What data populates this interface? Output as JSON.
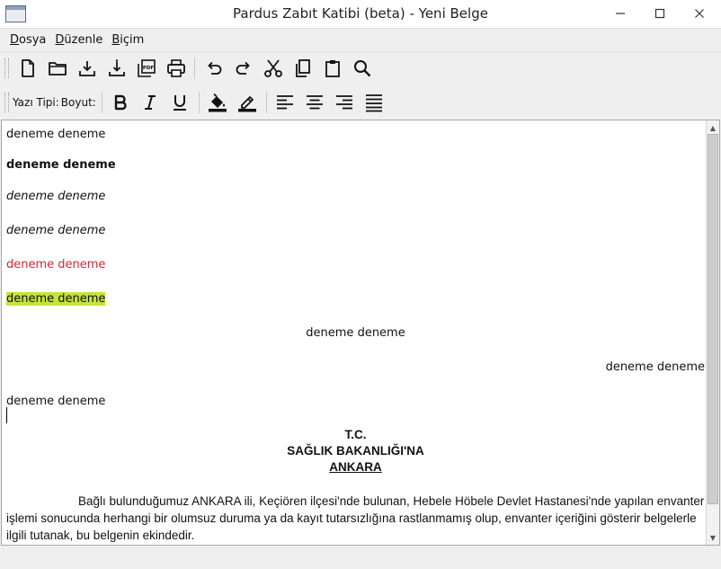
{
  "window": {
    "title": "Pardus Zabıt Katibi (beta) - Yeni Belge"
  },
  "menu": [
    {
      "accel": "D",
      "rest": "osya"
    },
    {
      "accel": "D",
      "rest": "üzenle"
    },
    {
      "accel": "B",
      "rest": "içim"
    }
  ],
  "format_toolbar": {
    "font_label": "Yazı Tipi:",
    "size_label": "Boyut:"
  },
  "document": {
    "lines": [
      "deneme deneme",
      "deneme deneme",
      "deneme deneme",
      "deneme deneme",
      "deneme deneme",
      "deneme deneme",
      "deneme deneme",
      "deneme deneme",
      "deneme deneme"
    ],
    "heading": [
      "T.C.",
      "SAĞLIK BAKANLIĞI'NA",
      "ANKARA"
    ],
    "paragraph": "Bağlı bulunduğumuz ANKARA ili, Keçiören ilçesi'nde bulunan, Hebele Höbele Devlet Hastanesi'nde yapılan envanter işlemi sonucunda herhangi bir olumsuz duruma ya da kayıt tutarsızlığına rastlanmamış olup, envanter içeriğini gösterir belgelerle ilgili tutanak, bu belgenin ekindedir."
  },
  "colors": {
    "red_text": "#d0283a",
    "highlight": "#c5e33b"
  },
  "scroll": {
    "position": 0.88
  }
}
